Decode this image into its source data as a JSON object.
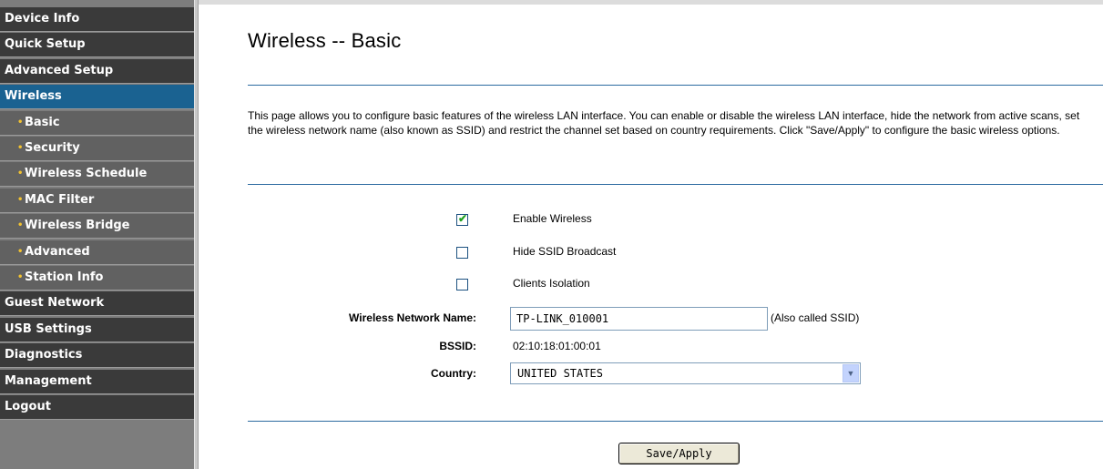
{
  "sidebar": {
    "items": [
      {
        "label": "Device Info",
        "kind": "main"
      },
      {
        "label": "Quick Setup",
        "kind": "main"
      },
      {
        "label": "Advanced Setup",
        "kind": "main"
      },
      {
        "label": "Wireless",
        "kind": "active"
      },
      {
        "label": "Basic",
        "kind": "sub"
      },
      {
        "label": "Security",
        "kind": "sub"
      },
      {
        "label": "Wireless Schedule",
        "kind": "sub"
      },
      {
        "label": "MAC Filter",
        "kind": "sub"
      },
      {
        "label": "Wireless Bridge",
        "kind": "sub"
      },
      {
        "label": "Advanced",
        "kind": "sub"
      },
      {
        "label": "Station Info",
        "kind": "sub"
      },
      {
        "label": "Guest Network",
        "kind": "main"
      },
      {
        "label": "USB Settings",
        "kind": "main"
      },
      {
        "label": "Diagnostics",
        "kind": "main"
      },
      {
        "label": "Management",
        "kind": "main"
      },
      {
        "label": "Logout",
        "kind": "main"
      }
    ],
    "bullet_icon": "bullet-icon"
  },
  "page": {
    "title": "Wireless -- Basic",
    "description": "This page allows you to configure basic features of the wireless LAN interface. You can enable or disable the wireless LAN interface, hide the network from active scans, set the wireless network name (also known as SSID) and restrict the channel set based on country requirements. Click \"Save/Apply\" to configure the basic wireless options."
  },
  "options": {
    "enable_wireless": {
      "label": "Enable Wireless",
      "checked": true
    },
    "hide_ssid": {
      "label": "Hide SSID Broadcast",
      "checked": false
    },
    "clients_isolation": {
      "label": "Clients Isolation",
      "checked": false
    }
  },
  "fields": {
    "ssid_label": "Wireless Network Name:",
    "ssid_value": "TP-LINK_010001",
    "ssid_note": "(Also called SSID)",
    "bssid_label": "BSSID:",
    "bssid_value": "02:10:18:01:00:01",
    "country_label": "Country:",
    "country_value": "UNITED STATES"
  },
  "actions": {
    "save_label": "Save/Apply"
  },
  "colors": {
    "nav_main": "#3a3a3a",
    "nav_active": "#1a6291",
    "nav_sub": "#616161",
    "bullet": "#f2c230",
    "rule": "#2c6aa0",
    "check": "#21a121"
  }
}
